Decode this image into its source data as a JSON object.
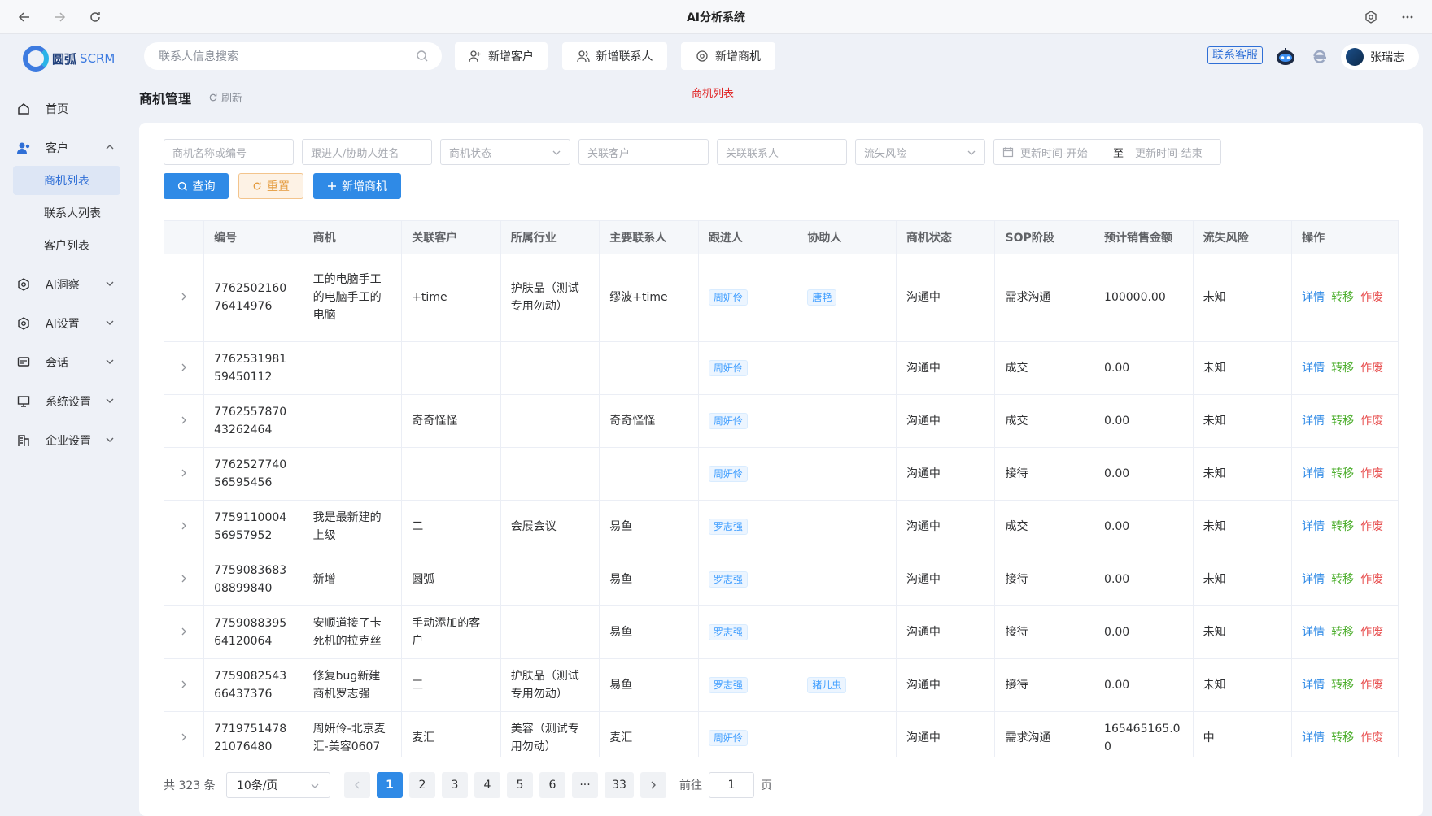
{
  "window": {
    "title": "AI分析系统"
  },
  "app": {
    "logo_text": "圆弧",
    "logo_suffix": "SCRM"
  },
  "header": {
    "search_placeholder": "联系人信息搜索",
    "btn_new_customer": "新增客户",
    "btn_new_contact": "新增联系人",
    "btn_new_opportunity": "新增商机",
    "contact_service": "联系客服",
    "user_name": "张瑞志"
  },
  "sidebar": {
    "home": "首页",
    "customer": "客户",
    "sub": [
      "商机列表",
      "联系人列表",
      "客户列表"
    ],
    "ai_insight": "AI洞察",
    "ai_settings": "AI设置",
    "conversation": "会话",
    "system_settings": "系统设置",
    "enterprise_settings": "企业设置"
  },
  "page": {
    "title": "商机管理",
    "refresh": "刷新",
    "note": "商机列表"
  },
  "filters": {
    "name": "商机名称或编号",
    "follower": "跟进人/协助人姓名",
    "status": "商机状态",
    "customer": "关联客户",
    "contact": "关联联系人",
    "risk": "流失风险",
    "date_start": "更新时间-开始",
    "date_sep": "至",
    "date_end": "更新时间-结束"
  },
  "actions": {
    "query": "查询",
    "reset": "重置",
    "add": "新增商机"
  },
  "table": {
    "columns": [
      "编号",
      "商机",
      "关联客户",
      "所属行业",
      "主要联系人",
      "跟进人",
      "协助人",
      "商机状态",
      "SOP阶段",
      "预计销售金额",
      "流失风险",
      "操作"
    ],
    "ops": {
      "detail": "详情",
      "transfer": "转移",
      "void": "作废"
    },
    "rows": [
      {
        "id": "776250216076414976",
        "opp": "工的电脑手工的电脑手工的电脑",
        "cust": "+time",
        "industry": "护肤品（测试专用勿动）",
        "contact": "缪波+time",
        "follower": "周妍伶",
        "assistant": "唐艳",
        "status": "沟通中",
        "sop": "需求沟通",
        "amount": "100000.00",
        "risk": "未知"
      },
      {
        "id": "776253198159450112",
        "opp": "",
        "cust": "",
        "industry": "",
        "contact": "",
        "follower": "周妍伶",
        "assistant": "",
        "status": "沟通中",
        "sop": "成交",
        "amount": "0.00",
        "risk": "未知"
      },
      {
        "id": "776255787043262464",
        "opp": "",
        "cust": "奇奇怪怪",
        "industry": "",
        "contact": "奇奇怪怪",
        "follower": "周妍伶",
        "assistant": "",
        "status": "沟通中",
        "sop": "成交",
        "amount": "0.00",
        "risk": "未知"
      },
      {
        "id": "776252774056595456",
        "opp": "",
        "cust": "",
        "industry": "",
        "contact": "",
        "follower": "周妍伶",
        "assistant": "",
        "status": "沟通中",
        "sop": "接待",
        "amount": "0.00",
        "risk": "未知"
      },
      {
        "id": "775911000456957952",
        "opp": "我是最新建的上级",
        "cust": "二",
        "industry": "会展会议",
        "contact": "易鱼",
        "follower": "罗志强",
        "assistant": "",
        "status": "沟通中",
        "sop": "成交",
        "amount": "0.00",
        "risk": "未知"
      },
      {
        "id": "775908368308899840",
        "opp": "新增",
        "cust": "圆弧",
        "industry": "",
        "contact": "易鱼",
        "follower": "罗志强",
        "assistant": "",
        "status": "沟通中",
        "sop": "接待",
        "amount": "0.00",
        "risk": "未知"
      },
      {
        "id": "775908839564120064",
        "opp": "安顺道接了卡死机的拉克丝",
        "cust": "手动添加的客户",
        "industry": "",
        "contact": "易鱼",
        "follower": "罗志强",
        "assistant": "",
        "status": "沟通中",
        "sop": "接待",
        "amount": "0.00",
        "risk": "未知"
      },
      {
        "id": "775908254366437376",
        "opp": "修复bug新建商机罗志强",
        "cust": "三",
        "industry": "护肤品（测试专用勿动）",
        "contact": "易鱼",
        "follower": "罗志强",
        "assistant": "猪儿虫",
        "status": "沟通中",
        "sop": "接待",
        "amount": "0.00",
        "risk": "未知"
      },
      {
        "id": "771975147821076480",
        "opp": "周妍伶-北京麦汇-美容0607",
        "cust": "麦汇",
        "industry": "美容（测试专用勿动）",
        "contact": "麦汇",
        "follower": "周妍伶",
        "assistant": "",
        "status": "沟通中",
        "sop": "需求沟通",
        "amount": "165465165.00",
        "risk": "中"
      }
    ]
  },
  "pagination": {
    "total": "共 323 条",
    "page_size": "10条/页",
    "pages": [
      "1",
      "2",
      "3",
      "4",
      "5",
      "6",
      "···",
      "33"
    ],
    "current": "1",
    "goto_label": "前往",
    "goto_value": "1",
    "page_unit": "页"
  },
  "colors": {
    "primary": "#2f8ae6",
    "transfer": "#4cae2c",
    "void": "#e85151",
    "warn": "#e49a3c"
  }
}
